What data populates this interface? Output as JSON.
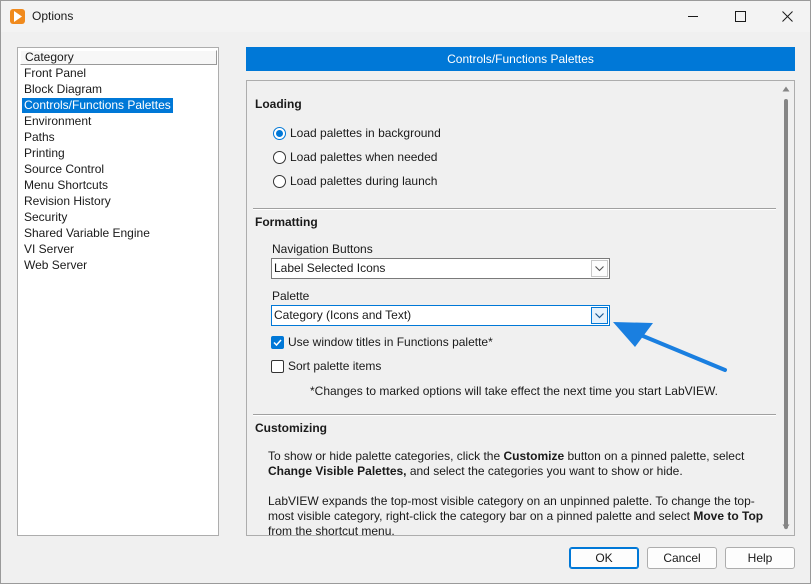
{
  "window": {
    "title": "Options",
    "controls": {
      "minimize": "minimize-icon",
      "maximize": "maximize-icon",
      "close": "close-icon"
    }
  },
  "sidebar": {
    "header": "Category",
    "items": [
      "Front Panel",
      "Block Diagram",
      "Controls/Functions Palettes",
      "Environment",
      "Paths",
      "Printing",
      "Source Control",
      "Menu Shortcuts",
      "Revision History",
      "Security",
      "Shared Variable Engine",
      "VI Server",
      "Web Server"
    ],
    "selected_index": 2
  },
  "panel": {
    "title": "Controls/Functions Palettes",
    "loading": {
      "title": "Loading",
      "options": [
        "Load palettes in background",
        "Load palettes when needed",
        "Load palettes during launch"
      ],
      "selected_index": 0
    },
    "formatting": {
      "title": "Formatting",
      "nav_label": "Navigation Buttons",
      "nav_value": "Label Selected Icons",
      "palette_label": "Palette",
      "palette_value": "Category (Icons and Text)",
      "window_titles_label": "Use window titles in Functions palette*",
      "window_titles_checked": true,
      "sort_label": "Sort palette items",
      "sort_checked": false,
      "note": "*Changes to marked options will take effect the next time you start LabVIEW."
    },
    "customizing": {
      "title": "Customizing",
      "p1_a": "To show or hide palette categories, click the ",
      "p1_b": "Customize",
      "p1_c": " button on a pinned palette, select ",
      "p1_d": "Change Visible Palettes,",
      "p1_e": " and select the categories you want to show or hide.",
      "p2_a": "LabVIEW expands the top-most visible category on an unpinned palette. To change the top-most visible category, right-click the category bar on a pinned palette and select ",
      "p2_b": "Move to Top",
      "p2_c": " from the shortcut menu."
    }
  },
  "buttons": {
    "ok": "OK",
    "cancel": "Cancel",
    "help": "Help"
  },
  "colors": {
    "accent": "#0078d7",
    "annotation_arrow": "#1a7fe0",
    "app_icon": "#f08a1d"
  }
}
